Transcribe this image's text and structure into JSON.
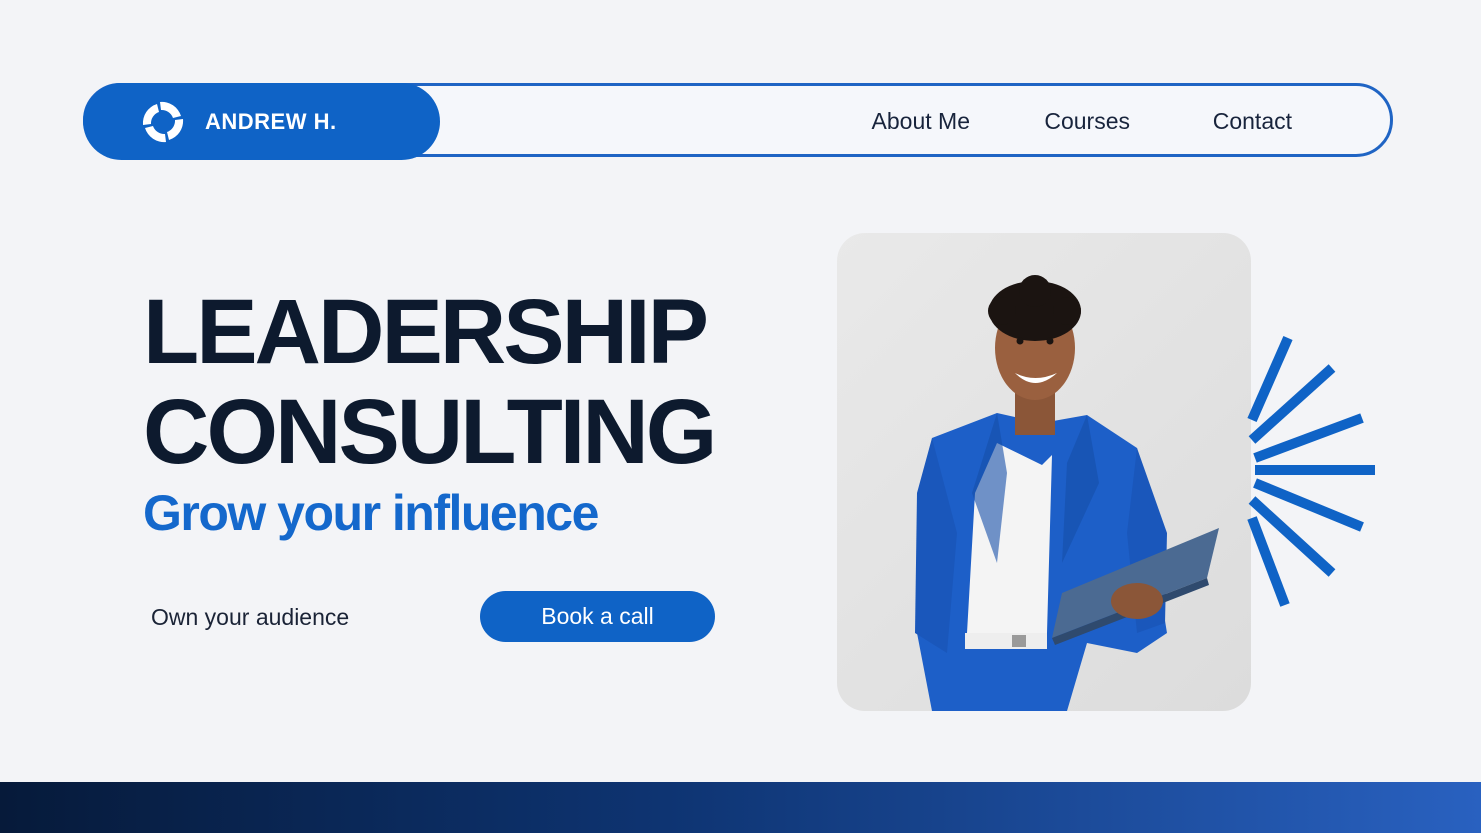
{
  "brand": {
    "name": "ANDREW H.",
    "logo_icon": "swirl-logo-icon"
  },
  "nav": {
    "links": [
      {
        "label": "About Me"
      },
      {
        "label": "Courses"
      },
      {
        "label": "Contact"
      }
    ]
  },
  "hero": {
    "headline_line1": "LEADERSHIP",
    "headline_line2": "CONSULTING",
    "subheadline": "Grow your influence",
    "tagline": "Own your audience",
    "cta_label": "Book a call"
  },
  "decor": {
    "burst_icon": "sunburst-icon"
  },
  "colors": {
    "accent": "#0f63c6",
    "headline": "#0d1a2e",
    "background": "#f3f4f7",
    "footer_gradient_start": "#061a3a",
    "footer_gradient_end": "#2961c0"
  }
}
